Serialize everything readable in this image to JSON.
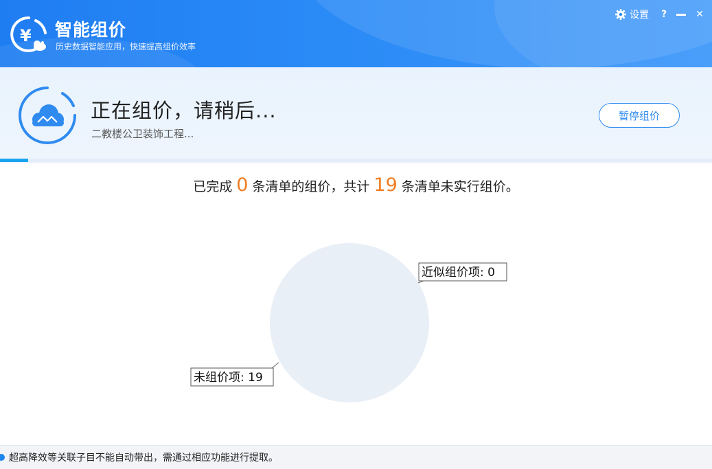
{
  "app": {
    "title": "智能组价",
    "subtitle": "历史数据智能应用，快速提高组价效率"
  },
  "window_controls": {
    "settings_label": "设置",
    "help_label": "?",
    "close_label": "✕"
  },
  "status": {
    "title": "正在组价，请稍后...",
    "project": "二教楼公卫装饰工程...",
    "pause_button": "暂停组价",
    "progress": 0.04
  },
  "summary": {
    "prefix": "已完成",
    "completed": "0",
    "middle": "条清单的组价，共计",
    "total": "19",
    "suffix": "条清单未实行组价。"
  },
  "chart_data": {
    "type": "pie",
    "slices": [
      {
        "label": "近似组价项: 0",
        "value": 0
      },
      {
        "label": "未组价项: 19",
        "value": 19
      }
    ],
    "colors": [
      "#2f8bf0",
      "#e9eff6"
    ]
  },
  "footer": {
    "note": "超高降效等关联子目不能自动带出，需通过相应功能进行提取。"
  },
  "colors": {
    "brand": "#1f7df2",
    "accent_number": "#f07d22",
    "button_border": "#2f8bf0"
  }
}
